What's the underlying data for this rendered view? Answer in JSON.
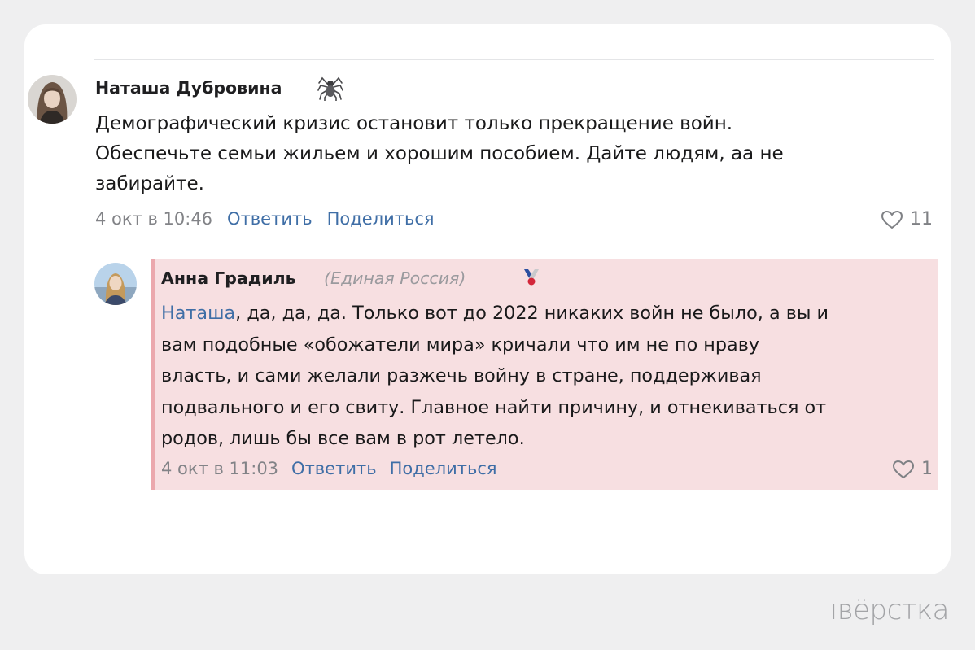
{
  "comment_main": {
    "author": "Наташа Дубровина",
    "author_emoji": "spider-icon",
    "text_lines": [
      "Демографический кризис остановит только прекращение войн.",
      "Обеспечьте семьи жильем и хорошим пособием. Дайте людям, аа не",
      "забирайте."
    ],
    "timestamp": "4 окт в 10:46",
    "reply_label": "Ответить",
    "share_label": "Поделиться",
    "likes": "11"
  },
  "comment_reply": {
    "author": "Анна Градиль",
    "affiliation": "(Единая Россия)",
    "author_badge": "party-ribbon-icon",
    "mention": "Наташа",
    "text_lines": [
      ", да, да, да. Только вот до 2022 никаких войн не было, а вы и",
      "вам подобные «обожатели мира» кричали что им не по нраву",
      "власть, и сами желали разжечь войну в стране, поддерживая",
      "подвального и его свиту. Главное найти причину, и отнекиваться от",
      "родов, лишь бы все вам в рот летело."
    ],
    "timestamp": "4 окт в 11:03",
    "reply_label": "Ответить",
    "share_label": "Поделиться",
    "likes": "1",
    "highlight_color": "#f7dfe1",
    "highlight_border_color": "#eba8ad"
  },
  "link_color": "#3f6ea6",
  "watermark": "ıвёрстка"
}
